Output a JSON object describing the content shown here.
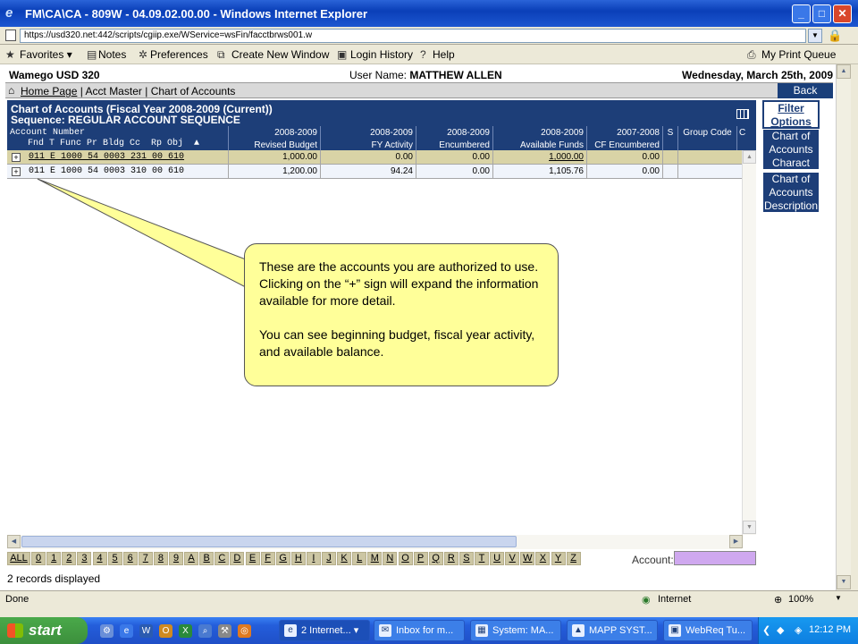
{
  "window": {
    "title": "FM\\CA\\CA - 809W - 04.09.02.00.00 - Windows Internet Explorer",
    "url": "https://usd320.net:442/scripts/cgiip.exe/WService=wsFin/facctbrws001.w"
  },
  "toolbar": {
    "favorites": "Favorites",
    "notes": "Notes",
    "preferences": "Preferences",
    "create_window": "Create New Window",
    "login_history": "Login History",
    "help": "Help",
    "print_queue": "My Print Queue"
  },
  "header": {
    "district": "Wamego USD 320",
    "user_label": "User Name:",
    "user_name": "MATTHEW ALLEN",
    "date": "Wednesday, March 25th, 2009"
  },
  "breadcrumb": {
    "home": "Home Page",
    "acct_master": "Acct Master",
    "chart": "Chart of Accounts",
    "sep": "|",
    "back": "Back"
  },
  "grid": {
    "title": "Chart of Accounts (Fiscal Year 2008-2009 (Current))",
    "sequence": "Sequence: REGULAR ACCOUNT SEQUENCE",
    "acct_header_1": "Account Number",
    "acct_header_2": "Fnd T Func Pr Bldg Cc  Rp Obj  ▲",
    "columns": [
      {
        "year": "2008-2009",
        "label": "Revised Budget"
      },
      {
        "year": "2008-2009",
        "label": "FY Activity"
      },
      {
        "year": "2008-2009",
        "label": "Encumbered"
      },
      {
        "year": "2008-2009",
        "label": "Available Funds"
      },
      {
        "year": "2007-2008",
        "label": "CF Encumbered"
      },
      {
        "year": "",
        "label": "S"
      },
      {
        "year": "",
        "label": "Group Code"
      },
      {
        "year": "",
        "label": "C"
      }
    ],
    "rows": [
      {
        "account": "011 E 1000 54 0003 231 00 610",
        "revised": "1,000.00",
        "activity": "0.00",
        "encumbered": "0.00",
        "available": "1,000.00",
        "cf": "0.00"
      },
      {
        "account": "011 E 1000 54 0003 310 00 610",
        "revised": "1,200.00",
        "activity": "94.24",
        "encumbered": "0.00",
        "available": "1,105.76",
        "cf": "0.00"
      }
    ]
  },
  "side": {
    "filter": "Filter Options",
    "charact": "Chart of Accounts Charact",
    "description": "Chart of Accounts Description"
  },
  "alpha": [
    "ALL",
    "0",
    "1",
    "2",
    "3",
    "4",
    "5",
    "6",
    "7",
    "8",
    "9",
    "A",
    "B",
    "C",
    "D",
    "E",
    "F",
    "G",
    "H",
    "I",
    "J",
    "K",
    "L",
    "M",
    "N",
    "O",
    "P",
    "Q",
    "R",
    "S",
    "T",
    "U",
    "V",
    "W",
    "X",
    "Y",
    "Z"
  ],
  "footer": {
    "account_label": "Account:",
    "records": "2 records displayed"
  },
  "callout": {
    "p1": "These are the accounts you are authorized to use.  Clicking on the “+” sign will expand the information available for more detail.",
    "p2": "You can see beginning budget, fiscal year activity, and available balance."
  },
  "status": {
    "done": "Done",
    "zone": "Internet",
    "zoom": "100%"
  },
  "taskbar": {
    "start": "start",
    "tasks": [
      "2 Internet...",
      "Inbox for m...",
      "System: MA...",
      "MAPP SYST...",
      "WebReq Tu..."
    ],
    "clock": "12:12 PM"
  },
  "colors": {
    "grid_header": "#1d3e78",
    "row_selected": "#d9d3a6",
    "callout": "#ffff99",
    "account_input": "#cfa8ef"
  }
}
